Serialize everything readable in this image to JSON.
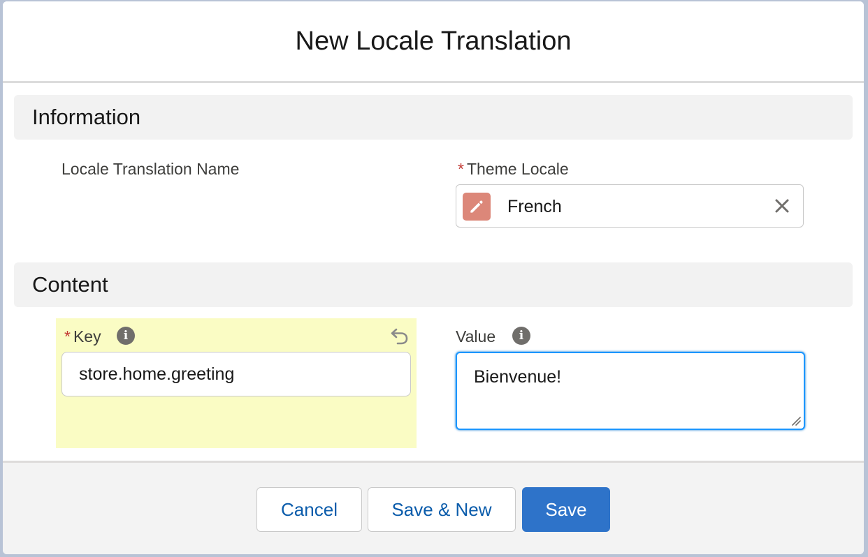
{
  "modal": {
    "title": "New Locale Translation"
  },
  "sections": {
    "information": "Information",
    "content": "Content"
  },
  "fields": {
    "locale_translation_name": {
      "label": "Locale Translation Name"
    },
    "theme_locale": {
      "label": "Theme Locale",
      "required": true,
      "value": "French",
      "icon": "pencil-icon",
      "icon_color": "#dc8779"
    },
    "key": {
      "label": "Key",
      "required": true,
      "value": "store.home.greeting",
      "highlight_color": "#fafcc4"
    },
    "value": {
      "label": "Value",
      "value": "Bienvenue!"
    }
  },
  "footer": {
    "cancel": "Cancel",
    "save_new": "Save & New",
    "save": "Save"
  },
  "colors": {
    "brand": "#2e73c9",
    "required": "#c23934",
    "focus": "#1b96ff"
  }
}
